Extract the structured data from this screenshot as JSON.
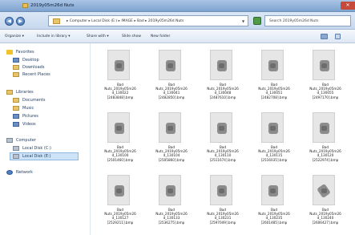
{
  "window": {
    "title": "2019y05m26d Nuts"
  },
  "address": {
    "path": "▸ Computer ▸ Local Disk (E:) ▸ IMAGE ▸ Bad ▸ 2019y05m26d Nuts",
    "search_placeholder": "Search 2019y05m26d Nuts"
  },
  "toolbar": {
    "organize": "Organize ▾",
    "include": "Include in library ▾",
    "share": "Share with ▾",
    "slideshow": "Slide show",
    "new_folder": "New folder"
  },
  "sidebar": {
    "favorites": "Favorites",
    "fav_items": [
      "Desktop",
      "Downloads",
      "Recent Places"
    ],
    "libraries": "Libraries",
    "lib_items": [
      "Documents",
      "Music",
      "Pictures",
      "Videos"
    ],
    "computer": "Computer",
    "drives": [
      "Local Disk (C:)",
      "Local Disk (E:)"
    ],
    "network": "Network"
  },
  "files": [
    {
      "l1": "Bad",
      "l2": "Nuts_2019y05m26",
      "l3": "d_130022",
      "l4": "[2483848].bmp"
    },
    {
      "l1": "Bad",
      "l2": "Nuts_2019y05m26",
      "l3": "d_130041",
      "l4": "[2482850].bmp"
    },
    {
      "l1": "Bad",
      "l2": "Nuts_2019y05m26",
      "l3": "d_130048",
      "l4": "[2487610].bmp"
    },
    {
      "l1": "Bad",
      "l2": "Nuts_2019y05m26",
      "l3": "d_130051",
      "l4": "[2482708].bmp"
    },
    {
      "l1": "Bad",
      "l2": "Nuts_2019y05m26",
      "l3": "d_130055",
      "l4": "[2497170].bmp"
    },
    {
      "l1": "Bad",
      "l2": "Nuts_2019y05m26",
      "l3": "d_130100",
      "l4": "[2501460].bmp"
    },
    {
      "l1": "Bad",
      "l2": "Nuts_2019y05m26",
      "l3": "d_130104",
      "l4": "[2505860].bmp"
    },
    {
      "l1": "Bad",
      "l2": "Nuts_2019y05m26",
      "l3": "d_130110",
      "l4": "[2511674].bmp"
    },
    {
      "l1": "Bad",
      "l2": "Nuts_2019y05m26",
      "l3": "d_130115",
      "l4": "[2516035].bmp"
    },
    {
      "l1": "Bad",
      "l2": "Nuts_2019y05m26",
      "l3": "d_130120",
      "l4": "[2522974].bmp"
    },
    {
      "l1": "Bad",
      "l2": "Nuts_2019y05m26",
      "l3": "d_130127",
      "l4": "[2529211].bmp"
    },
    {
      "l1": "Bad",
      "l2": "Nuts_2019y05m26",
      "l3": "d_130133",
      "l4": "[2536275].bmp"
    },
    {
      "l1": "Bad",
      "l2": "Nuts_2019y05m26",
      "l3": "d_130231",
      "l4": "[2597049].bmp"
    },
    {
      "l1": "Bad",
      "l2": "Nuts_2019y05m26",
      "l3": "d_130235",
      "l4": "[2601485].bmp"
    },
    {
      "l1": "Bad",
      "l2": "Nuts_2019y05m26",
      "l3": "d_130240",
      "l4": "[2606427].bmp"
    }
  ]
}
